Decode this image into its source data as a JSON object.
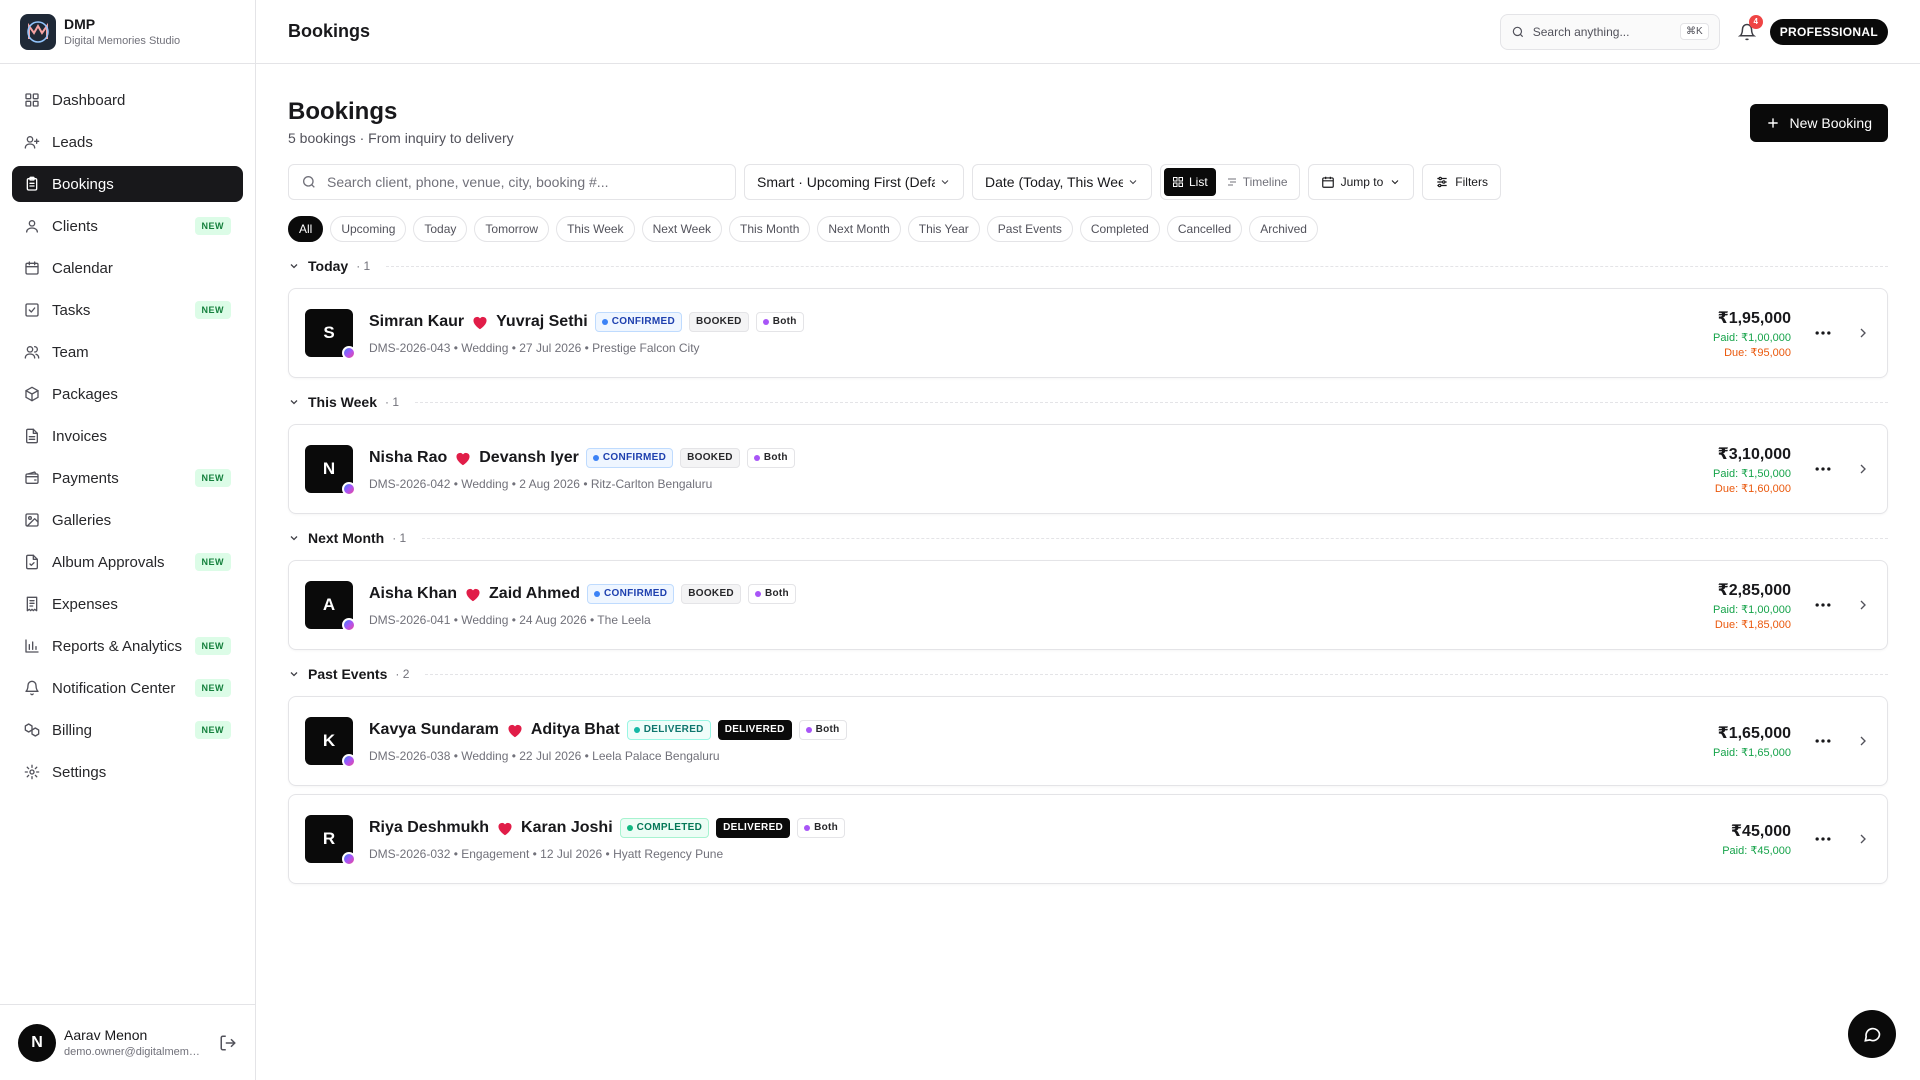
{
  "brand": {
    "name": "DMP",
    "subtitle": "Digital Memories Studio"
  },
  "sidebar": {
    "items": [
      {
        "label": "Dashboard",
        "icon": "dashboard-icon",
        "active": false,
        "badge": ""
      },
      {
        "label": "Leads",
        "icon": "user-plus-icon",
        "active": false,
        "badge": ""
      },
      {
        "label": "Bookings",
        "icon": "clipboard-icon",
        "active": true,
        "badge": ""
      },
      {
        "label": "Clients",
        "icon": "user-icon",
        "active": false,
        "badge": "NEW"
      },
      {
        "label": "Calendar",
        "icon": "calendar-icon",
        "active": false,
        "badge": ""
      },
      {
        "label": "Tasks",
        "icon": "check-square-icon",
        "active": false,
        "badge": "NEW"
      },
      {
        "label": "Team",
        "icon": "users-icon",
        "active": false,
        "badge": ""
      },
      {
        "label": "Packages",
        "icon": "package-icon",
        "active": false,
        "badge": ""
      },
      {
        "label": "Invoices",
        "icon": "file-icon",
        "active": false,
        "badge": ""
      },
      {
        "label": "Payments",
        "icon": "wallet-icon",
        "active": false,
        "badge": "NEW"
      },
      {
        "label": "Galleries",
        "icon": "image-icon",
        "active": false,
        "badge": ""
      },
      {
        "label": "Album Approvals",
        "icon": "file-check-icon",
        "active": false,
        "badge": "NEW"
      },
      {
        "label": "Expenses",
        "icon": "receipt-icon",
        "active": false,
        "badge": ""
      },
      {
        "label": "Reports & Analytics",
        "icon": "bar-chart-icon",
        "active": false,
        "badge": "NEW"
      },
      {
        "label": "Notification Center",
        "icon": "bell-icon",
        "active": false,
        "badge": "NEW"
      },
      {
        "label": "Billing",
        "icon": "boxes-icon",
        "active": false,
        "badge": "NEW"
      },
      {
        "label": "Settings",
        "icon": "gear-icon",
        "active": false,
        "badge": ""
      }
    ]
  },
  "user": {
    "initial": "N",
    "name": "Aarav Menon",
    "email": "demo.owner@digitalmemories.studio"
  },
  "topbar": {
    "title": "Bookings",
    "search_placeholder": "Search anything...",
    "shortcut": "⌘K",
    "notifications": "4",
    "plan": "PROFESSIONAL"
  },
  "page": {
    "title": "Bookings",
    "subtitle": "5 bookings · From inquiry to delivery",
    "new_button": "New Booking"
  },
  "toolbar": {
    "search_placeholder": "Search client, phone, venue, city, booking #...",
    "sort_value": "Smart · Upcoming First (Default)",
    "date_value": "Date (Today, This Week)",
    "view_list": "List",
    "view_timeline": "Timeline",
    "jump_to": "Jump to",
    "filters": "Filters"
  },
  "filter_chips": [
    "All",
    "Upcoming",
    "Today",
    "Tomorrow",
    "This Week",
    "Next Week",
    "This Month",
    "Next Month",
    "This Year",
    "Past Events",
    "Completed",
    "Cancelled",
    "Archived"
  ],
  "active_chip": "All",
  "groups": [
    {
      "title": "Today",
      "count": "· 1",
      "bookings": [
        {
          "initial": "S",
          "name1": "Simran Kaur",
          "name2": "Yuvraj Sethi",
          "status": "CONFIRMED",
          "status_style": "confirmed",
          "stage": "BOOKED",
          "stage_style": "booked",
          "coverage": "Both",
          "meta": "DMS-2026-043 • Wedding • 27 Jul 2026 • Prestige Falcon City",
          "total": "₹1,95,000",
          "paid": "Paid: ₹1,00,000",
          "due": "Due: ₹95,000"
        }
      ]
    },
    {
      "title": "This Week",
      "count": "· 1",
      "bookings": [
        {
          "initial": "N",
          "name1": "Nisha Rao",
          "name2": "Devansh Iyer",
          "status": "CONFIRMED",
          "status_style": "confirmed",
          "stage": "BOOKED",
          "stage_style": "booked",
          "coverage": "Both",
          "meta": "DMS-2026-042 • Wedding • 2 Aug 2026 • Ritz-Carlton Bengaluru",
          "total": "₹3,10,000",
          "paid": "Paid: ₹1,50,000",
          "due": "Due: ₹1,60,000"
        }
      ]
    },
    {
      "title": "Next Month",
      "count": "· 1",
      "bookings": [
        {
          "initial": "A",
          "name1": "Aisha Khan",
          "name2": "Zaid Ahmed",
          "status": "CONFIRMED",
          "status_style": "confirmed",
          "stage": "BOOKED",
          "stage_style": "booked",
          "coverage": "Both",
          "meta": "DMS-2026-041 • Wedding • 24 Aug 2026 • The Leela",
          "total": "₹2,85,000",
          "paid": "Paid: ₹1,00,000",
          "due": "Due: ₹1,85,000"
        }
      ]
    },
    {
      "title": "Past Events",
      "count": "· 2",
      "bookings": [
        {
          "initial": "K",
          "name1": "Kavya Sundaram",
          "name2": "Aditya Bhat",
          "status": "DELIVERED",
          "status_style": "delivered",
          "stage": "DELIVERED",
          "stage_style": "deliv-dark",
          "coverage": "Both",
          "meta": "DMS-2026-038 • Wedding • 22 Jul 2026 • Leela Palace Bengaluru",
          "total": "₹1,65,000",
          "paid": "Paid: ₹1,65,000",
          "due": ""
        },
        {
          "initial": "R",
          "name1": "Riya Deshmukh",
          "name2": "Karan Joshi",
          "status": "COMPLETED",
          "status_style": "completed",
          "stage": "DELIVERED",
          "stage_style": "deliv-dark",
          "coverage": "Both",
          "meta": "DMS-2026-032 • Engagement • 12 Jul 2026 • Hyatt Regency Pune",
          "total": "₹45,000",
          "paid": "Paid: ₹45,000",
          "due": ""
        }
      ]
    }
  ],
  "colors": {
    "accent": "#0a0a0a",
    "paid": "#16a34a",
    "due": "#ea580c",
    "confirmed": "#3b82f6",
    "heart": "#e11d48"
  }
}
